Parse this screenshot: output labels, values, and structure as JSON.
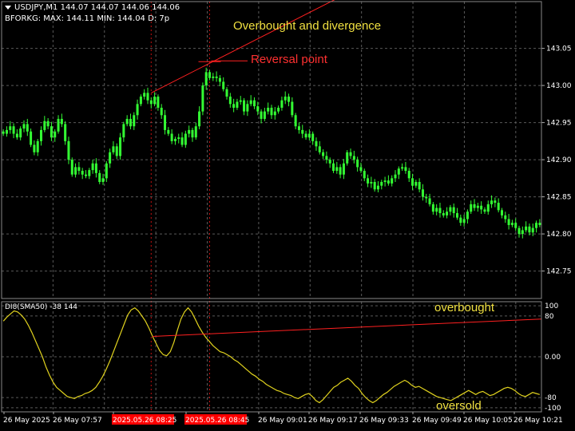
{
  "header": {
    "symbol_line": "USDJPY,M1  144.07 144.07 144.06 144.06",
    "indicator_line": "BFORKG: MAX: 144.11 MIN: 144.04 D: 7p"
  },
  "indicator": {
    "title": "DI8(SMA50)  -38 144"
  },
  "annotations": {
    "divergence": "Overbought and divergence",
    "reversal": "Reversal point",
    "overbought": "overbought",
    "oversold": "oversold"
  },
  "colors": {
    "background": "#000000",
    "candle": "#33ff33",
    "trend": "#ff2020",
    "indicator_line": "#e0d21e",
    "label_yellow": "#f0e040",
    "label_red": "#ff3030",
    "grid": "#5a5a5a",
    "axis_text": "#ffffff",
    "time_highlight": "#ff0000"
  },
  "chart_data": {
    "type": "candlestick",
    "symbol": "USDJPY",
    "timeframe": "M1",
    "price_ticks": [
      "143.05",
      "143.00",
      "142.95",
      "142.90",
      "142.85",
      "142.80",
      "142.75"
    ],
    "price_range": [
      142.713,
      143.113
    ],
    "time_labels": [
      "26 May 2025",
      "26 May 07:57",
      "2025.05.26 08:25",
      "2025.05.26 08:45",
      "26 May 09:01",
      "26 May 09:17",
      "26 May 09:33",
      "26 May 09:49",
      "26 May 10:05",
      "26 May 10:21"
    ],
    "highlighted_times": [
      "2025.05.26 08:25",
      "2025.05.26 08:45"
    ],
    "indicator_ticks": [
      "100",
      "80",
      "0.00",
      "-80",
      "-100"
    ],
    "indicator_range": [
      -108,
      108
    ],
    "indicator_levels": [
      100,
      80,
      0,
      -80,
      -100
    ],
    "closes": [
      142.935,
      142.94,
      142.945,
      142.935,
      142.93,
      142.942,
      142.948,
      142.938,
      142.92,
      142.91,
      142.925,
      142.94,
      142.952,
      142.945,
      142.93,
      142.938,
      142.955,
      142.948,
      142.925,
      142.9,
      142.88,
      142.89,
      142.885,
      142.88,
      142.878,
      142.886,
      142.895,
      142.882,
      142.87,
      142.875,
      142.895,
      142.91,
      142.918,
      142.905,
      142.93,
      142.948,
      142.955,
      142.945,
      142.96,
      142.975,
      142.985,
      142.99,
      142.98,
      142.975,
      142.985,
      142.97,
      142.96,
      142.94,
      142.935,
      142.925,
      142.928,
      142.93,
      142.92,
      142.935,
      142.94,
      142.93,
      142.945,
      142.965,
      143.0,
      143.018,
      143.01,
      143.012,
      143.01,
      143.005,
      142.995,
      142.985,
      142.975,
      142.97,
      142.978,
      142.98,
      142.965,
      142.975,
      142.98,
      142.972,
      142.965,
      142.955,
      142.965,
      142.97,
      142.96,
      142.965,
      142.97,
      142.98,
      142.985,
      142.978,
      142.96,
      142.945,
      142.94,
      142.935,
      142.93,
      142.935,
      142.925,
      142.918,
      142.91,
      142.905,
      142.9,
      142.895,
      142.885,
      142.89,
      142.88,
      142.895,
      142.91,
      142.905,
      142.9,
      142.89,
      142.885,
      142.875,
      142.868,
      142.87,
      142.86,
      142.865,
      142.87,
      142.872,
      142.868,
      142.875,
      142.88,
      142.888,
      142.89,
      142.885,
      142.875,
      142.865,
      142.87,
      142.86,
      142.85,
      142.848,
      142.84,
      142.83,
      142.835,
      142.828,
      142.825,
      142.83,
      142.836,
      142.828,
      142.822,
      142.815,
      142.82,
      142.83,
      142.84,
      142.835,
      142.838,
      142.833,
      142.83,
      142.84,
      142.845,
      142.842,
      142.832,
      142.825,
      142.82,
      142.812,
      142.815,
      142.808,
      142.8,
      142.805,
      142.81,
      142.802,
      142.808,
      142.815,
      142.812
    ],
    "indicator_values": [
      70,
      78,
      84,
      90,
      88,
      82,
      74,
      62,
      48,
      32,
      16,
      0,
      -20,
      -36,
      -50,
      -60,
      -66,
      -72,
      -78,
      -80,
      -82,
      -78,
      -76,
      -72,
      -70,
      -66,
      -60,
      -50,
      -38,
      -24,
      -8,
      10,
      28,
      46,
      64,
      82,
      92,
      96,
      90,
      80,
      70,
      56,
      40,
      26,
      12,
      4,
      2,
      10,
      28,
      52,
      74,
      88,
      96,
      88,
      74,
      60,
      48,
      38,
      30,
      22,
      16,
      10,
      8,
      4,
      0,
      -6,
      -10,
      -16,
      -22,
      -28,
      -34,
      -38,
      -44,
      -48,
      -54,
      -58,
      -62,
      -66,
      -68,
      -72,
      -74,
      -76,
      -80,
      -82,
      -78,
      -74,
      -72,
      -78,
      -86,
      -90,
      -84,
      -76,
      -68,
      -60,
      -56,
      -50,
      -46,
      -42,
      -48,
      -56,
      -62,
      -72,
      -80,
      -86,
      -90,
      -86,
      -80,
      -74,
      -70,
      -64,
      -58,
      -54,
      -50,
      -46,
      -50,
      -56,
      -60,
      -58,
      -62,
      -66,
      -70,
      -74,
      -78,
      -80,
      -82,
      -84,
      -86,
      -82,
      -78,
      -74,
      -70,
      -66,
      -70,
      -74,
      -70,
      -68,
      -72,
      -76,
      -74,
      -70,
      -66,
      -62,
      -60,
      -62,
      -66,
      -72,
      -76,
      -78,
      -74,
      -70,
      -72,
      -74
    ]
  }
}
